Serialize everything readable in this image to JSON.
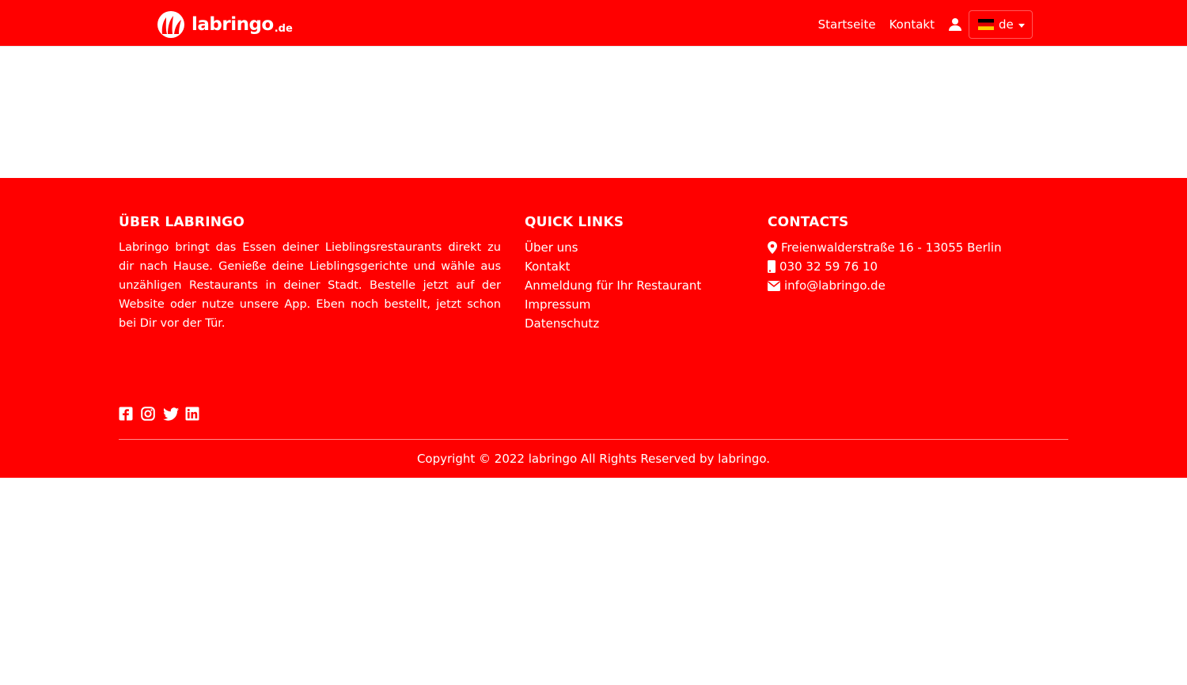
{
  "header": {
    "logo": {
      "brand": "labringo",
      "tld": ".de"
    },
    "nav": [
      {
        "label": "Startseite"
      },
      {
        "label": "Kontakt"
      }
    ],
    "user_icon": "user-icon",
    "language": {
      "code": "de",
      "flag": "germany-flag-icon"
    }
  },
  "footer": {
    "about": {
      "heading": "ÜBER LABRINGO",
      "text": "Labringo bringt das Essen deiner Lieblingsrestaurants direkt zu dir nach Hause. Genieße deine Lieblingsgerichte und wähle aus unzähligen Restaurants in deiner Stadt. Bestelle jetzt auf der Website oder nutze unsere App. Eben noch bestellt, jetzt schon bei Dir vor der Tür."
    },
    "quick_links": {
      "heading": "QUICK LINKS",
      "items": [
        {
          "label": "Über uns"
        },
        {
          "label": "Kontakt"
        },
        {
          "label": "Anmeldung für Ihr Restaurant"
        },
        {
          "label": "Impressum"
        },
        {
          "label": "Datenschutz"
        }
      ]
    },
    "contacts": {
      "heading": "CONTACTS",
      "address": "Freienwalderstraße 16 - 13055 Berlin",
      "phone": "030 32 59 76 10",
      "email": "info@labringo.de"
    },
    "social": [
      "facebook-icon",
      "instagram-icon",
      "twitter-icon",
      "linkedin-icon"
    ],
    "copyright": "Copyright © 2022 labringo All Rights Reserved by labringo."
  },
  "colors": {
    "brand": "#ff0000",
    "text_on_brand": "#ffffff",
    "background": "#ffffff"
  }
}
